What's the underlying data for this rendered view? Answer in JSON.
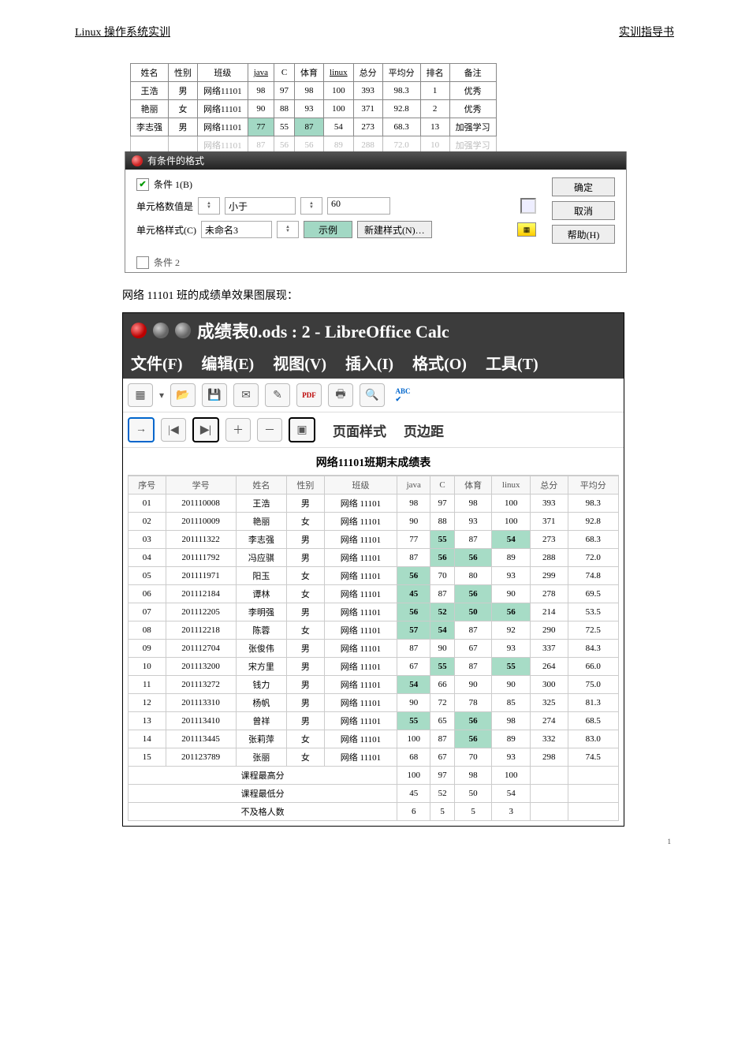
{
  "header": {
    "left": "Linux 操作系统实训",
    "right": "实训指导书"
  },
  "table1": {
    "headers": [
      "姓名",
      "性别",
      "班级",
      "java",
      "C",
      "体育",
      "linux",
      "总分",
      "平均分",
      "排名",
      "备注"
    ],
    "rows": [
      {
        "cells": [
          "王浩",
          "男",
          "网络11101",
          "98",
          "97",
          "98",
          "100",
          "393",
          "98.3",
          "1",
          "优秀"
        ],
        "hl": []
      },
      {
        "cells": [
          "艳丽",
          "女",
          "网络11101",
          "90",
          "88",
          "93",
          "100",
          "371",
          "92.8",
          "2",
          "优秀"
        ],
        "hl": []
      },
      {
        "cells": [
          "李志强",
          "男",
          "网络11101",
          "77",
          "55",
          "87",
          "54",
          "273",
          "68.3",
          "13",
          "加强学习"
        ],
        "hl": [
          4,
          6
        ]
      },
      {
        "cells": [
          "",
          "",
          "网络11101",
          "87",
          "56",
          "56",
          "89",
          "288",
          "72.0",
          "10",
          "加强学习"
        ],
        "fade": true,
        "hl": []
      }
    ]
  },
  "cond": {
    "bar_title": "有条件的格式",
    "cond1_label": "条件 1(B)",
    "cell_value_is": "单元格数值是",
    "less_than": "小于",
    "value": "60",
    "cell_style": "单元格样式(C)",
    "style_name": "未命名3",
    "example": "示例",
    "new_style": "新建样式(N)…",
    "ok": "确定",
    "cancel": "取消",
    "help": "帮助(H)",
    "cond2_label": "条件 2"
  },
  "caption": "网络  11101 班的成绩单效果图展现：",
  "lo": {
    "title": "成绩表0.ods : 2 - LibreOffice Calc",
    "menu": [
      "文件(F)",
      "编辑(E)",
      "视图(V)",
      "插入(I)",
      "格式(O)",
      "工具(T)"
    ],
    "tool2": {
      "page_style": "页面样式",
      "page_margin": "页边距"
    }
  },
  "sheet2": {
    "title": "网络11101班期末成绩表",
    "headers": [
      "序号",
      "学号",
      "姓名",
      "性别",
      "班级",
      "java",
      "C",
      "体育",
      "linux",
      "总分",
      "平均分"
    ],
    "rows": [
      {
        "cells": [
          "01",
          "201110008",
          "王浩",
          "男",
          "网络 11101",
          "98",
          "97",
          "98",
          "100",
          "393",
          "98.3"
        ],
        "hl": []
      },
      {
        "cells": [
          "02",
          "201110009",
          "艳丽",
          "女",
          "网络 11101",
          "90",
          "88",
          "93",
          "100",
          "371",
          "92.8"
        ],
        "hl": []
      },
      {
        "cells": [
          "03",
          "201111322",
          "李志强",
          "男",
          "网络 11101",
          "77",
          "55",
          "87",
          "54",
          "273",
          "68.3"
        ],
        "hl": [
          6,
          8
        ]
      },
      {
        "cells": [
          "04",
          "201111792",
          "冯应骐",
          "男",
          "网络 11101",
          "87",
          "56",
          "56",
          "89",
          "288",
          "72.0"
        ],
        "hl": [
          6,
          7
        ]
      },
      {
        "cells": [
          "05",
          "201111971",
          "阳玉",
          "女",
          "网络 11101",
          "56",
          "70",
          "80",
          "93",
          "299",
          "74.8"
        ],
        "hl": [
          5
        ]
      },
      {
        "cells": [
          "06",
          "201112184",
          "谭林",
          "女",
          "网络 11101",
          "45",
          "87",
          "56",
          "90",
          "278",
          "69.5"
        ],
        "hl": [
          5,
          7
        ]
      },
      {
        "cells": [
          "07",
          "201112205",
          "李明强",
          "男",
          "网络 11101",
          "56",
          "52",
          "50",
          "56",
          "214",
          "53.5"
        ],
        "hl": [
          5,
          6,
          7,
          8
        ]
      },
      {
        "cells": [
          "08",
          "201112218",
          "陈蓉",
          "女",
          "网络 11101",
          "57",
          "54",
          "87",
          "92",
          "290",
          "72.5"
        ],
        "hl": [
          5,
          6
        ]
      },
      {
        "cells": [
          "09",
          "201112704",
          "张俊伟",
          "男",
          "网络 11101",
          "87",
          "90",
          "67",
          "93",
          "337",
          "84.3"
        ],
        "hl": []
      },
      {
        "cells": [
          "10",
          "201113200",
          "宋方里",
          "男",
          "网络 11101",
          "67",
          "55",
          "87",
          "55",
          "264",
          "66.0"
        ],
        "hl": [
          6,
          8
        ]
      },
      {
        "cells": [
          "11",
          "201113272",
          "钱力",
          "男",
          "网络 11101",
          "54",
          "66",
          "90",
          "90",
          "300",
          "75.0"
        ],
        "hl": [
          5
        ]
      },
      {
        "cells": [
          "12",
          "201113310",
          "杨帆",
          "男",
          "网络 11101",
          "90",
          "72",
          "78",
          "85",
          "325",
          "81.3"
        ],
        "hl": []
      },
      {
        "cells": [
          "13",
          "201113410",
          "曾祥",
          "男",
          "网络 11101",
          "55",
          "65",
          "56",
          "98",
          "274",
          "68.5"
        ],
        "hl": [
          5,
          7
        ]
      },
      {
        "cells": [
          "14",
          "201113445",
          "张莉萍",
          "女",
          "网络 11101",
          "100",
          "87",
          "56",
          "89",
          "332",
          "83.0"
        ],
        "hl": [
          7
        ]
      },
      {
        "cells": [
          "15",
          "201123789",
          "张丽",
          "女",
          "网络 11101",
          "68",
          "67",
          "70",
          "93",
          "298",
          "74.5"
        ],
        "hl": []
      }
    ],
    "summary": [
      {
        "label": "课程最高分",
        "vals": [
          "100",
          "97",
          "98",
          "100",
          "",
          ""
        ]
      },
      {
        "label": "课程最低分",
        "vals": [
          "45",
          "52",
          "50",
          "54",
          "",
          ""
        ]
      },
      {
        "label": "不及格人数",
        "vals": [
          "6",
          "5",
          "5",
          "3",
          "",
          ""
        ]
      }
    ]
  },
  "footer_page": "1"
}
